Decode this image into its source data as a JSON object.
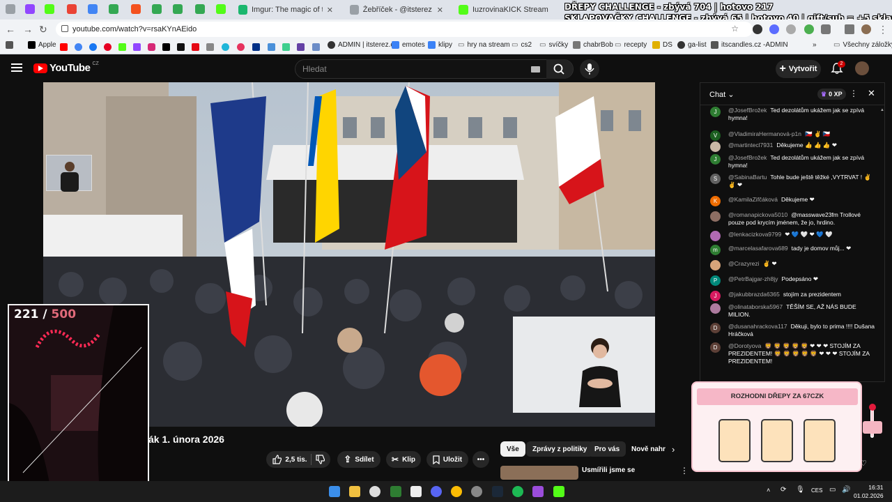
{
  "browser": {
    "tabs": [
      {
        "label": "Imgur: The magic of the Interne",
        "icon": "imgur-icon",
        "color": "#1bb76e"
      },
      {
        "label": "Žebříček - @itsterez panel",
        "icon": "panel-icon",
        "color": "#9aa0a6"
      },
      {
        "label": "IuzrovinaKICK Stream - Watch L",
        "icon": "kick-icon",
        "color": "#53fc18"
      }
    ],
    "url": "youtube.com/watch?v=rsaKYnAEido",
    "bookmarks": [
      "Apple",
      "ADMIN | itsterez.cz",
      "emotes",
      "klipy",
      "hry na stream",
      "cs2",
      "svíčky",
      "chabrBob",
      "recepty",
      "DS",
      "ga-list",
      "itscandles.cz -ADMIN",
      "Všechny záložky"
    ]
  },
  "stream_overlay": {
    "line1": "DŘEPY CHALLENGE - zbývá 704 | hotovo 217",
    "line2": "SKLAPOVAČKY CHALLENGE - zbývá 65 | hotovo 40 | gift/sub = +5 sklapovaček",
    "counter_current": "221 /",
    "counter_goal": "500"
  },
  "youtube": {
    "logo": "YouTube",
    "region": "CZ",
    "search_placeholder": "Hledat",
    "create_label": "Vytvořit",
    "notification_count": "2",
    "video_title": "ák 1. února 2026",
    "actions": {
      "like_count": "2,5 tis.",
      "share": "Sdílet",
      "clip": "Klip",
      "save": "Uložit"
    },
    "chips": [
      "Vše",
      "Zprávy z politiky",
      "Pro vás",
      "Nově nahr"
    ],
    "recommended_title": "Usmířili jsme se"
  },
  "chat": {
    "title": "Chat",
    "xp": "0 XP",
    "messages": [
      {
        "user": "@JosefBrožek",
        "text": "Ted dezolátům ukážem jak se zpívá hymna!",
        "initial": "J",
        "color": "#2e7d32"
      },
      {
        "user": "@VladimiraHermanová-p1n",
        "text": "🇨🇿 ✌ 🇨🇿",
        "initial": "V",
        "color": "#1b5e20"
      },
      {
        "user": "@martintecl7931",
        "text": "Děkujeme 👍 👍 👍 ❤",
        "initial": "",
        "color": "#c9b8a6"
      },
      {
        "user": "@JosefBrožek",
        "text": "Ted dezolátům ukážem jak se zpívá hymna!",
        "initial": "J",
        "color": "#2e7d32"
      },
      {
        "user": "@SabinaBartu",
        "text": "Tohle bude ještě těžké ,VYTRVAT ! ✌ ✌ ❤",
        "initial": "S",
        "color": "#616161"
      },
      {
        "user": "@KamilaZifčáková",
        "text": "Děkujeme ❤",
        "initial": "K",
        "color": "#ef6c00"
      },
      {
        "user": "@romanapickova5010",
        "text": "@masswave23fm Trollové pouze pod krycím jménem, že jo, hrdino.",
        "initial": "",
        "color": "#8d6e63"
      },
      {
        "user": "@lenkacizkova9799",
        "text": "❤ 💙 🤍 ❤ 💙 🤍",
        "initial": "",
        "color": "#b06ab3"
      },
      {
        "user": "@marcelasafarova689",
        "text": "tady je domov můj... ❤",
        "initial": "m",
        "color": "#2e7d32"
      },
      {
        "user": "@Crazyrezi",
        "text": "✌ ❤",
        "initial": "",
        "color": "#d7a47a"
      },
      {
        "user": "@PetrBajgar-zh8jy",
        "text": "Podepsáno ❤",
        "initial": "P",
        "color": "#00897b"
      },
      {
        "user": "@jakubbrazda6365",
        "text": "stojím za prezidentem",
        "initial": "J",
        "color": "#d81b60"
      },
      {
        "user": "@olinataborska5967",
        "text": "TĚŠÍM SE, AŽ NÁS BUDE MILION.",
        "initial": "",
        "color": "#ad7b9e"
      },
      {
        "user": "@dusanahrackova117",
        "text": "Děkuji, bylo to prima !!!! Dušana Hráčková",
        "initial": "D",
        "color": "#5d4037"
      },
      {
        "user": "@Dorotyova",
        "text": "🦁 🦁 🦁 🦁 🦁 ❤ ❤ ❤ STOJÍM ZA PREZIDENTEM! 🦁 🦁 🦁 🦁 🦁 ❤ ❤ ❤ STOJÍM ZA PREZIDENTEM!",
        "initial": "D",
        "color": "#5d4037"
      }
    ]
  },
  "widget": {
    "banner": "ROZHODNI DŘEPY ZA 67CZK"
  },
  "taskbar": {
    "time": "16:31",
    "date": "01.02.2026",
    "language": "CES"
  }
}
